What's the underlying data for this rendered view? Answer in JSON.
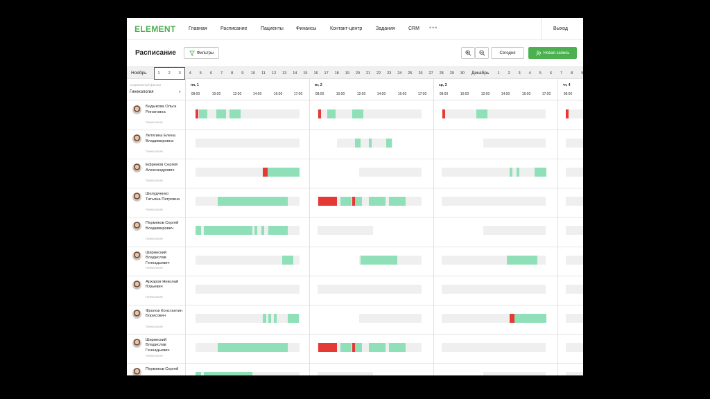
{
  "app": {
    "logo": "ELEMENT",
    "nav": [
      "Главная",
      "Расписание",
      "Пациенты",
      "Финансы",
      "Контакт-центр",
      "Задания",
      "CRM"
    ],
    "more": "•••",
    "logout": "Выход"
  },
  "toolbar": {
    "title": "Расписание",
    "filters": "Фильтры",
    "zoom_in_icon": "zoom-in-icon",
    "zoom_out_icon": "zoom-out-icon",
    "today": "Сегодня",
    "new_record": "Новая запись",
    "accent": "#4caf50"
  },
  "dates": {
    "month1": "Ноябрь",
    "nov": [
      "1",
      "2",
      "3",
      "4",
      "5",
      "6",
      "7",
      "8",
      "9",
      "10",
      "11",
      "12",
      "13",
      "14",
      "15",
      "16",
      "17",
      "18",
      "19",
      "20",
      "21",
      "22",
      "23",
      "24",
      "25",
      "26",
      "27",
      "28",
      "29",
      "30"
    ],
    "month2": "Декабрь",
    "dec": [
      "1",
      "2",
      "3",
      "4",
      "5",
      "6",
      "7",
      "8",
      "9"
    ]
  },
  "filter": {
    "label": "Сохранённый фильтр",
    "value": "Гинекология"
  },
  "days": [
    {
      "label": "пн, 1",
      "hours": [
        "08:00",
        "10:00",
        "12:00",
        "14:00",
        "16:00",
        "17:00"
      ]
    },
    {
      "label": "вт, 2",
      "hours": [
        "08:00",
        "10:00",
        "12:00",
        "14:00",
        "16:00",
        "17:00"
      ]
    },
    {
      "label": "ср, 3",
      "hours": [
        "08:00",
        "10:00",
        "12:00",
        "14:00",
        "16:00",
        "17:00"
      ]
    },
    {
      "label": "чт, 4",
      "hours": [
        "08:00"
      ]
    }
  ],
  "doctors": [
    {
      "name": "Бадыкова Ольга Ринатовна",
      "spec": "Гинекология"
    },
    {
      "name": "Летягина Елена Владимировна",
      "spec": "Гинекология"
    },
    {
      "name": "Ефремов Сергей Александрович",
      "spec": "Гинекология"
    },
    {
      "name": "Шелудченко Татьяна Петровна",
      "spec": "Гинекология"
    },
    {
      "name": "Пермяков Сергей Владимирович",
      "spec": "Гинекология"
    },
    {
      "name": "Ширинский Владислав Геннадьевич",
      "spec": "Гинекология"
    },
    {
      "name": "Архаров Николай Юрьевич",
      "spec": "Гинекология"
    },
    {
      "name": "Фролов Константин Борисович",
      "spec": "Гинекология"
    },
    {
      "name": "Ширинский Владислав Геннадьевич",
      "spec": "Гинекология"
    },
    {
      "name": "Пермяков Сергей",
      "spec": ""
    }
  ],
  "colors": {
    "booked": "#8fe0b8",
    "urgent": "#e53935",
    "free": "#efefef"
  }
}
